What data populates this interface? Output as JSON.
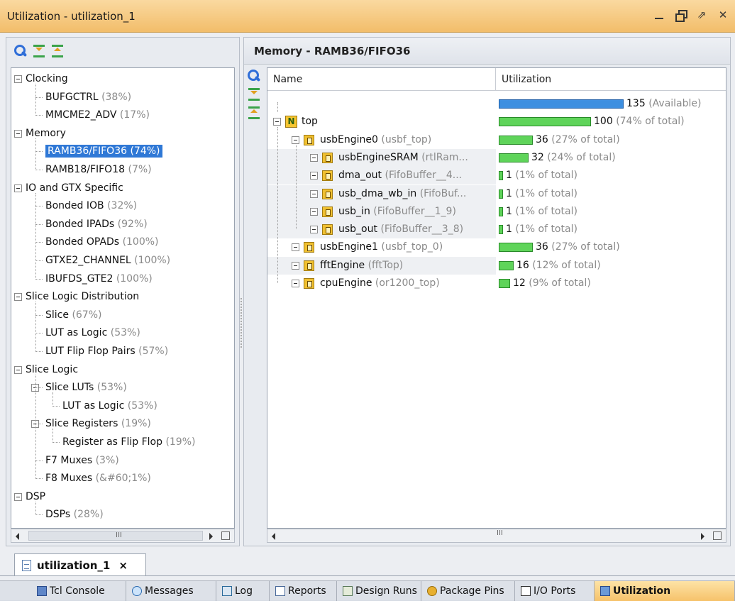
{
  "window": {
    "title": "Utilization - utilization_1"
  },
  "left": {
    "tree": [
      {
        "label": "Clocking",
        "pct": ""
      },
      {
        "label": "BUFGCTRL",
        "pct": "(38%)"
      },
      {
        "label": "MMCME2_ADV",
        "pct": "(17%)"
      },
      {
        "label": "Memory",
        "pct": ""
      },
      {
        "label": "RAMB36/FIFO36 (74%)",
        "pct": ""
      },
      {
        "label": "RAMB18/FIFO18",
        "pct": "(7%)"
      },
      {
        "label": "IO and GTX Specific",
        "pct": ""
      },
      {
        "label": "Bonded IOB",
        "pct": "(32%)"
      },
      {
        "label": "Bonded IPADs",
        "pct": "(92%)"
      },
      {
        "label": "Bonded OPADs",
        "pct": "(100%)"
      },
      {
        "label": "GTXE2_CHANNEL",
        "pct": "(100%)"
      },
      {
        "label": "IBUFDS_GTE2",
        "pct": "(100%)"
      },
      {
        "label": "Slice Logic Distribution",
        "pct": ""
      },
      {
        "label": "Slice",
        "pct": "(67%)"
      },
      {
        "label": "LUT as Logic",
        "pct": "(53%)"
      },
      {
        "label": "LUT Flip Flop Pairs",
        "pct": "(57%)"
      },
      {
        "label": "Slice Logic",
        "pct": ""
      },
      {
        "label": "Slice LUTs",
        "pct": "(53%)"
      },
      {
        "label": "LUT as Logic",
        "pct": "(53%)"
      },
      {
        "label": "Slice Registers",
        "pct": "(19%)"
      },
      {
        "label": "Register as Flip Flop",
        "pct": "(19%)"
      },
      {
        "label": "F7 Muxes",
        "pct": "(3%)"
      },
      {
        "label": "F8 Muxes",
        "pct": "(&#60;1%)"
      },
      {
        "label": "DSP",
        "pct": ""
      },
      {
        "label": "DSPs",
        "pct": "(28%)"
      }
    ],
    "scroll_grip": "III"
  },
  "right": {
    "header": "Memory - RAMB36/FIFO36",
    "columns": {
      "name": "Name",
      "utilization": "Utilization"
    },
    "rows": [
      {
        "inst": "",
        "mod": "",
        "value": "135",
        "detail": "(Available)",
        "fraction": 1.0,
        "color": "#3d8fe0"
      },
      {
        "inst": "top",
        "mod": "",
        "value": "100",
        "detail": "(74% of total)",
        "fraction": 0.74
      },
      {
        "inst": "usbEngine0",
        "mod": "(usbf_top)",
        "value": "36",
        "detail": "(27% of total)",
        "fraction": 0.27
      },
      {
        "inst": "usbEngineSRAM",
        "mod": "(rtlRam...",
        "value": "32",
        "detail": "(24% of total)",
        "fraction": 0.24
      },
      {
        "inst": "dma_out",
        "mod": "(FifoBuffer__4...",
        "value": "1",
        "detail": "(1% of total)",
        "fraction": 0.01
      },
      {
        "inst": "usb_dma_wb_in",
        "mod": "(FifoBuf...",
        "value": "1",
        "detail": "(1% of total)",
        "fraction": 0.01
      },
      {
        "inst": "usb_in",
        "mod": "(FifoBuffer__1_9)",
        "value": "1",
        "detail": "(1% of total)",
        "fraction": 0.01
      },
      {
        "inst": "usb_out",
        "mod": "(FifoBuffer__3_8)",
        "value": "1",
        "detail": "(1% of total)",
        "fraction": 0.01
      },
      {
        "inst": "usbEngine1",
        "mod": "(usbf_top_0)",
        "value": "36",
        "detail": "(27% of total)",
        "fraction": 0.27
      },
      {
        "inst": "fftEngine",
        "mod": "(fftTop)",
        "value": "16",
        "detail": "(12% of total)",
        "fraction": 0.12
      },
      {
        "inst": "cpuEngine",
        "mod": "(or1200_top)",
        "value": "12",
        "detail": "(9% of total)",
        "fraction": 0.09
      }
    ],
    "scroll_grip": "III"
  },
  "doc_tab": {
    "label": "utilization_1",
    "close": "×"
  },
  "bottom_tabs": [
    "Tcl Console",
    "Messages",
    "Log",
    "Reports",
    "Design Runs",
    "Package Pins",
    "I/O Ports",
    "Utilization"
  ]
}
